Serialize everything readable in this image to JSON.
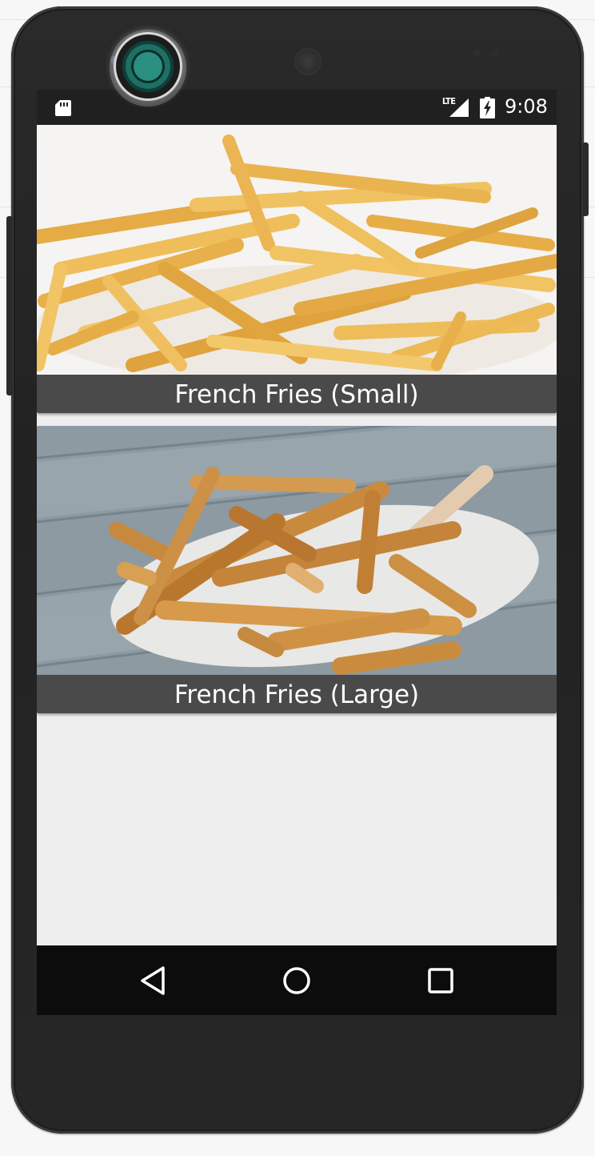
{
  "status_bar": {
    "network": "LTE",
    "time": "9:08"
  },
  "products": [
    {
      "name": "French Fries (Small)",
      "image": "fries-small-photo"
    },
    {
      "name": "French Fries (Large)",
      "image": "fries-large-photo"
    }
  ],
  "icons": {
    "sd_card": "sd-card-icon",
    "signal": "signal-icon",
    "battery": "battery-charging-icon",
    "back": "back-icon",
    "home": "home-icon",
    "recents": "recents-icon",
    "camera": "camera-icon"
  },
  "colors": {
    "caption_bg": "#4a4a4a",
    "screen_bg": "#eeeeee",
    "status_bar_bg": "#202020",
    "nav_bar_bg": "#0c0c0c",
    "camera_accent": "#1f6f64"
  }
}
